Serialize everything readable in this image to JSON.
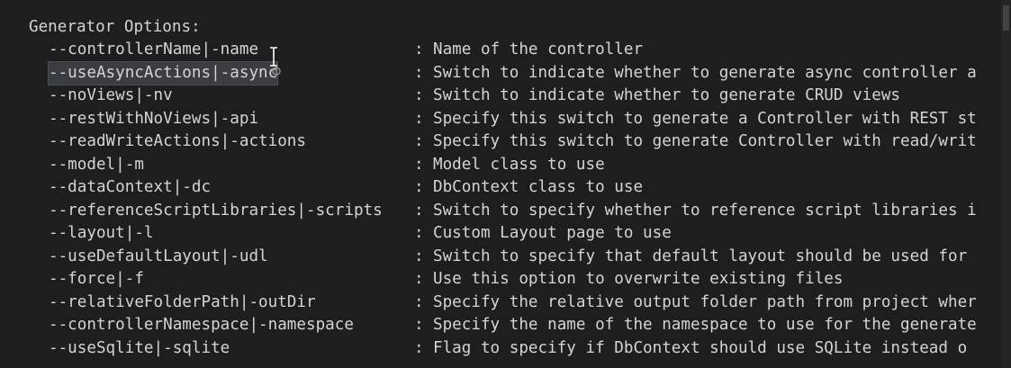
{
  "header": "Generator Options:",
  "separator": ":",
  "options": [
    {
      "flag": "--controllerName|-name",
      "desc": "Name of the controller"
    },
    {
      "flag": "--useAsyncActions|-async",
      "desc": "Switch to indicate whether to generate async controller a"
    },
    {
      "flag": "--noViews|-nv",
      "desc": "Switch to indicate whether to generate CRUD views"
    },
    {
      "flag": "--restWithNoViews|-api",
      "desc": "Specify this switch to generate a Controller with REST st"
    },
    {
      "flag": "--readWriteActions|-actions",
      "desc": "Specify this switch to generate Controller with read/writ"
    },
    {
      "flag": "--model|-m",
      "desc": "Model class to use"
    },
    {
      "flag": "--dataContext|-dc",
      "desc": "DbContext class to use"
    },
    {
      "flag": "--referenceScriptLibraries|-scripts",
      "desc": "Switch to specify whether to reference script libraries i"
    },
    {
      "flag": "--layout|-l",
      "desc": "Custom Layout page to use"
    },
    {
      "flag": "--useDefaultLayout|-udl",
      "desc": "Switch to specify that default layout should be used for"
    },
    {
      "flag": "--force|-f",
      "desc": "Use this option to overwrite existing files"
    },
    {
      "flag": "--relativeFolderPath|-outDir",
      "desc": "Specify the relative output folder path from project wher"
    },
    {
      "flag": "--controllerNamespace|-namespace",
      "desc": "Specify the name of the namespace to use for the generate"
    },
    {
      "flag": "--useSqlite|-sqlite",
      "desc": "Flag to specify if DbContext should use SQLite instead o"
    }
  ],
  "colors": {
    "background": "#1e1e1e",
    "text": "#d4d4d4",
    "selection": "#3a3d41"
  },
  "selected_option_index": 1,
  "icons": [
    "text-cursor-icon",
    "pointer-cursor-icon"
  ]
}
